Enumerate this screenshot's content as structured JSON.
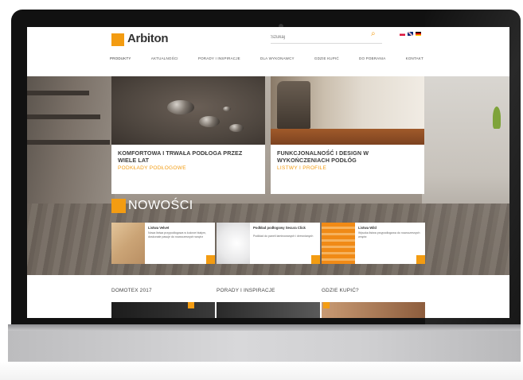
{
  "brand": {
    "name": "Arbiton",
    "accent_color": "#f39c12"
  },
  "search": {
    "placeholder": "Szukaj"
  },
  "languages": [
    "pl",
    "en",
    "de"
  ],
  "nav": [
    {
      "label": "PRODUKTY"
    },
    {
      "label": "AKTUALNOŚCI"
    },
    {
      "label": "PORADY I INSPIRACJE"
    },
    {
      "label": "DLA WYKONAWCY"
    },
    {
      "label": "GDZIE KUPIĆ"
    },
    {
      "label": "DO POBRANIA"
    },
    {
      "label": "KONTAKT"
    }
  ],
  "hero_cards": [
    {
      "title": "KOMFORTOWA I TRWAŁA PODŁOGA PRZEZ WIELE LAT",
      "subtitle": "PODKŁADY PODŁOGOWE"
    },
    {
      "title": "FUNKCJONALNOŚĆ I DESIGN W WYKOŃCZENIACH PODŁÓG",
      "subtitle": "LISTWY I PROFILE"
    }
  ],
  "new_section": {
    "title": "NOWOŚCI"
  },
  "new_products": [
    {
      "title": "Listwa Velvet",
      "desc": "Nowa listwa przypodłogowa w kolorze białym, doskonale pasuje do nowoczesnych wnętrz"
    },
    {
      "title": "Podkład podłogowy Secura Click",
      "desc": "Podkład do paneli laminowanych i drewnianych"
    },
    {
      "title": "Listwa Wild",
      "desc": "Wysoka listwa przypodłogowa do nowoczesnych wnętrz"
    }
  ],
  "bottom_sections": [
    {
      "title": "DOMOTEX 2017"
    },
    {
      "title": "PORADY I INSPIRACJE"
    },
    {
      "title": "GDZIE KUPIĆ?"
    }
  ]
}
